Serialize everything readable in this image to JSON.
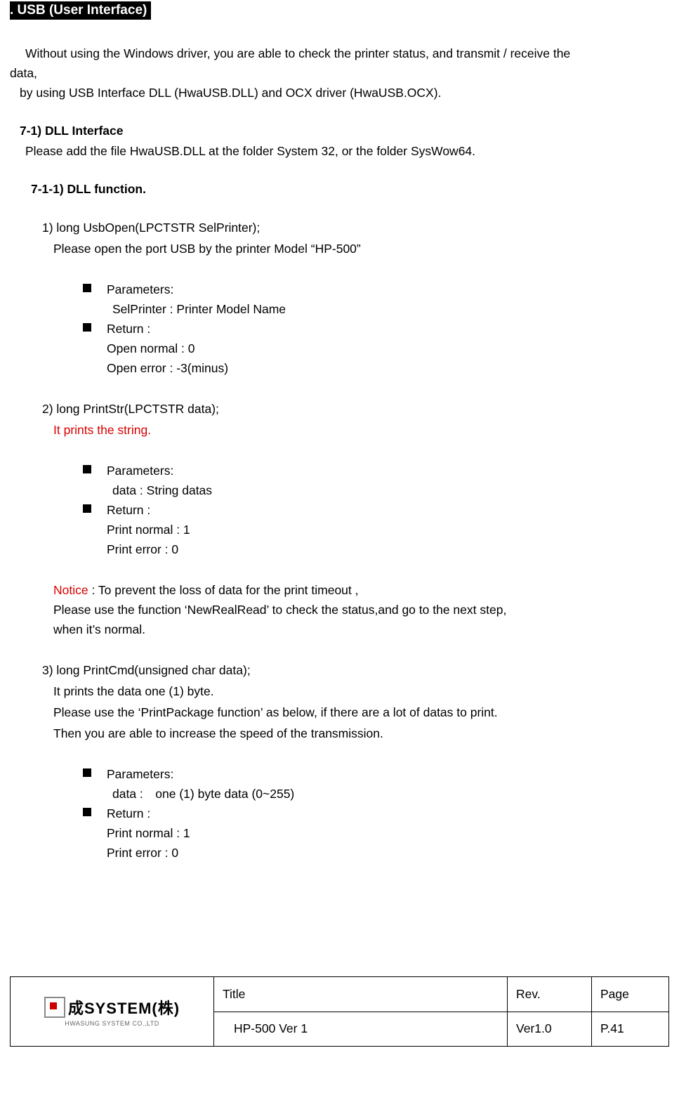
{
  "section_title": ". USB (User Interface)  ",
  "intro_line1": "Without using the Windows driver, you are able to check the printer status, and transmit / receive the",
  "intro_line2": "data,",
  "intro_line3": "by using USB Interface DLL (HwaUSB.DLL) and OCX driver (HwaUSB.OCX).",
  "h1": "7-1) DLL Interface",
  "h1_body": "Please add the file HwaUSB.DLL at the folder System 32, or the folder SysWow64.",
  "h2": "7-1-1) DLL function.",
  "fn1_title": "1) long UsbOpen(LPCTSTR SelPrinter);",
  "fn1_desc": "Please open the port USB by the printer Model “HP-500”",
  "fn1_param_label": "Parameters:",
  "fn1_param_detail": "SelPrinter : Printer Model Name",
  "fn1_return_label": "Return :",
  "fn1_return_1": "Open normal : 0",
  "fn1_return_2": "Open error : -3(minus)",
  "fn2_title": "2) long PrintStr(LPCTSTR data);",
  "fn2_desc": "It prints the string.",
  "fn2_param_label": "Parameters:",
  "fn2_param_detail": "data : String datas",
  "fn2_return_label": "Return :",
  "fn2_return_1": "Print normal : 1",
  "fn2_return_2": "Print error : 0",
  "notice_label": "Notice",
  "notice_1": " : To prevent the loss of data for the print timeout ,",
  "notice_2": "Please use the function ‘NewRealRead’ to check the status,and go to the next step,",
  "notice_3": "when it’s normal.",
  "fn3_title": "3) long PrintCmd(unsigned char data);",
  "fn3_desc1": "It prints the data one (1) byte.",
  "fn3_desc2": "Please use the ‘PrintPackage function’ as below, if there are a lot of datas to print.",
  "fn3_desc3": "Then you are able to increase the speed of the transmission.",
  "fn3_param_label": "Parameters:",
  "fn3_param_detail": "data : one (1) byte data (0~255)",
  "fn3_return_label": "Return :",
  "fn3_return_1": "Print normal : 1",
  "fn3_return_2": "Print error : 0",
  "logo_main": "成SYSTEM(株)",
  "logo_sub": "HWASUNG SYSTEM CO.,LTD",
  "footer": {
    "title_label": "Title",
    "rev_label": "Rev.",
    "page_label": "Page",
    "title_value": "HP-500 Ver 1",
    "rev_value": "Ver1.0",
    "page_value": "P.41"
  }
}
